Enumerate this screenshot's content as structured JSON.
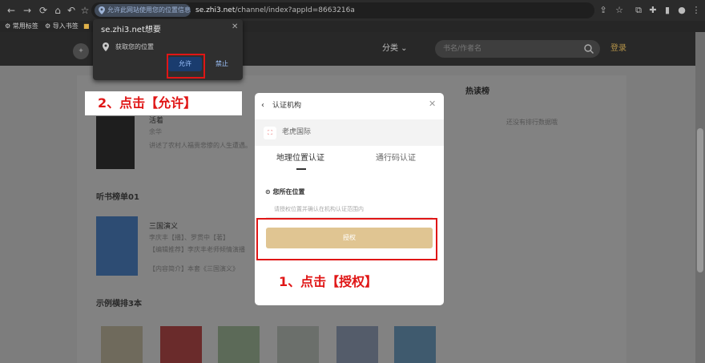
{
  "browser": {
    "permission_chip": "允许此网站使用您的位置信息?",
    "url_host": "se.zhi3.net",
    "url_path": "/channel/index?appId=8663216a",
    "bookmarks": [
      "常用标签",
      "导入书签"
    ]
  },
  "site": {
    "category": "分类",
    "search_placeholder": "书名/作者名",
    "login": "登录",
    "section_listen": "听书榜单01",
    "section_sample": "示例横排3本",
    "hot_title": "热读榜",
    "hot_empty": "还没有排行数据哦",
    "book1_title": "活着",
    "book1_author": "余华",
    "book1_desc": "讲述了农村人福贵悲惨的人生遭遇。",
    "book2_title": "三国演义",
    "book2_authors": "李庆丰【播】、罗贯中【著】",
    "book2_desc1": "【编辑推荐】李庆丰老师倾情演播",
    "book2_desc2": "【内容简介】本套《三国演义》"
  },
  "permission_popup": {
    "host": "se.zhi3.net想要",
    "request": "获取您的位置",
    "allow": "允许",
    "block": "禁止"
  },
  "modal": {
    "title": "认证机构",
    "org_name": "老虎国际",
    "tab_geo": "地理位置认证",
    "tab_code": "通行码认证",
    "location_label": "您所在位置",
    "location_placeholder": "请授权位置并确认在机构认证范围内",
    "auth_button": "授权"
  },
  "annotations": {
    "step1": "1、点击【授权】",
    "step2": "2、点击【允许】",
    "color_red": "#e01616"
  }
}
